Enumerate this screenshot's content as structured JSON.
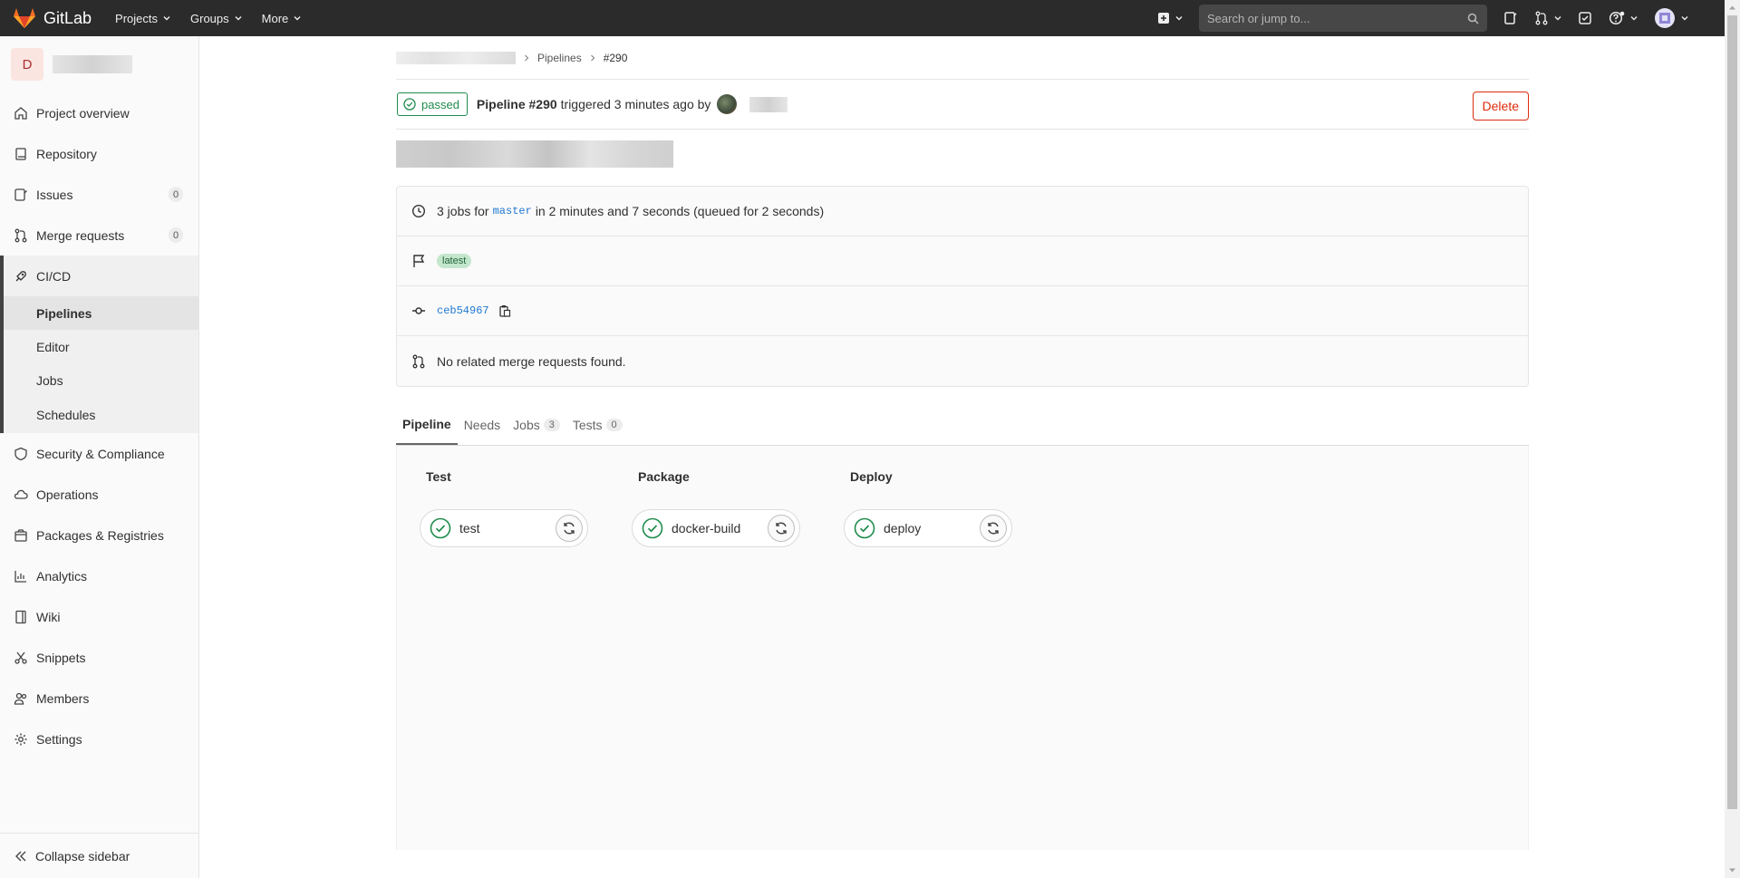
{
  "navbar": {
    "logo_text": "GitLab",
    "menu": [
      "Projects",
      "Groups",
      "More"
    ],
    "search_placeholder": "Search or jump to..."
  },
  "sidebar": {
    "project_initial": "D",
    "items": [
      {
        "label": "Project overview",
        "icon": "home-icon"
      },
      {
        "label": "Repository",
        "icon": "book-icon"
      },
      {
        "label": "Issues",
        "icon": "issues-icon",
        "count": "0"
      },
      {
        "label": "Merge requests",
        "icon": "merge-request-icon",
        "count": "0"
      }
    ],
    "cicd": {
      "label": "CI/CD",
      "subitems": [
        "Pipelines",
        "Editor",
        "Jobs",
        "Schedules"
      ]
    },
    "items_after": [
      {
        "label": "Security & Compliance",
        "icon": "shield-icon"
      },
      {
        "label": "Operations",
        "icon": "cloud-icon"
      },
      {
        "label": "Packages & Registries",
        "icon": "package-icon"
      },
      {
        "label": "Analytics",
        "icon": "chart-icon"
      },
      {
        "label": "Wiki",
        "icon": "wiki-icon"
      },
      {
        "label": "Snippets",
        "icon": "scissors-icon"
      },
      {
        "label": "Members",
        "icon": "users-icon"
      },
      {
        "label": "Settings",
        "icon": "gear-icon"
      }
    ],
    "collapse_label": "Collapse sidebar"
  },
  "breadcrumb": {
    "pipelines": "Pipelines",
    "current": "#290"
  },
  "pipeline": {
    "status": "passed",
    "title": "Pipeline #290",
    "triggered_text": "triggered 3 minutes ago by",
    "delete_label": "Delete"
  },
  "info": {
    "jobs_prefix": "3 jobs for",
    "branch": "master",
    "jobs_suffix": "in 2 minutes and 7 seconds (queued for 2 seconds)",
    "badge": "latest",
    "commit_sha": "ceb54967",
    "mr_text": "No related merge requests found."
  },
  "tabs": [
    {
      "label": "Pipeline",
      "active": true
    },
    {
      "label": "Needs"
    },
    {
      "label": "Jobs",
      "count": "3"
    },
    {
      "label": "Tests",
      "count": "0"
    }
  ],
  "stages": [
    {
      "title": "Test",
      "job": "test"
    },
    {
      "title": "Package",
      "job": "docker-build"
    },
    {
      "title": "Deploy",
      "job": "deploy"
    }
  ],
  "colors": {
    "success": "#1f8b4c",
    "danger": "#dd2b0e",
    "link": "#1f78d1",
    "navbar": "#2b2b2b"
  }
}
